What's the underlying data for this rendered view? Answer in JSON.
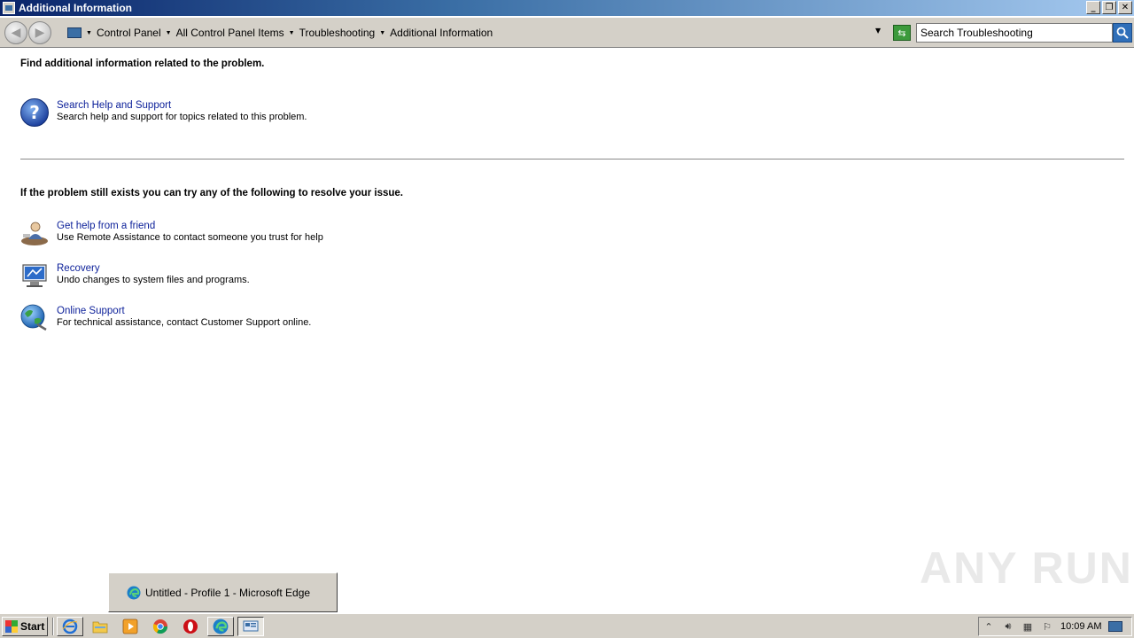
{
  "window": {
    "title": "Additional Information",
    "minimize": "_",
    "restore": "❐",
    "close": "✕"
  },
  "nav": {
    "back_icon": "arrow-left-icon",
    "forward_icon": "arrow-right-icon",
    "breadcrumbs": [
      "Control Panel",
      "All Control Panel Items",
      "Troubleshooting",
      "Additional Information"
    ],
    "search_placeholder": "Search Troubleshooting"
  },
  "content": {
    "heading1": "Find additional information related to the problem.",
    "help": {
      "link": "Search Help and Support",
      "desc": "Search help and support for topics related to this problem."
    },
    "heading2": "If the problem still exists you can try any of the following to resolve your issue.",
    "items": [
      {
        "link": "Get help from a friend",
        "desc": "Use Remote Assistance to contact someone you trust for help"
      },
      {
        "link": "Recovery",
        "desc": "Undo changes to system files and programs."
      },
      {
        "link": "Online Support",
        "desc": "For technical assistance, contact Customer Support online."
      }
    ]
  },
  "popup": {
    "label": "Untitled - Profile 1 - Microsoft Edge"
  },
  "watermark": "ANY RUN",
  "taskbar": {
    "start_label": "Start",
    "clock": "10:09 AM"
  },
  "colors": {
    "link": "#0b1f99",
    "titlebar_start": "#0a246a",
    "titlebar_end": "#a6caf0"
  }
}
